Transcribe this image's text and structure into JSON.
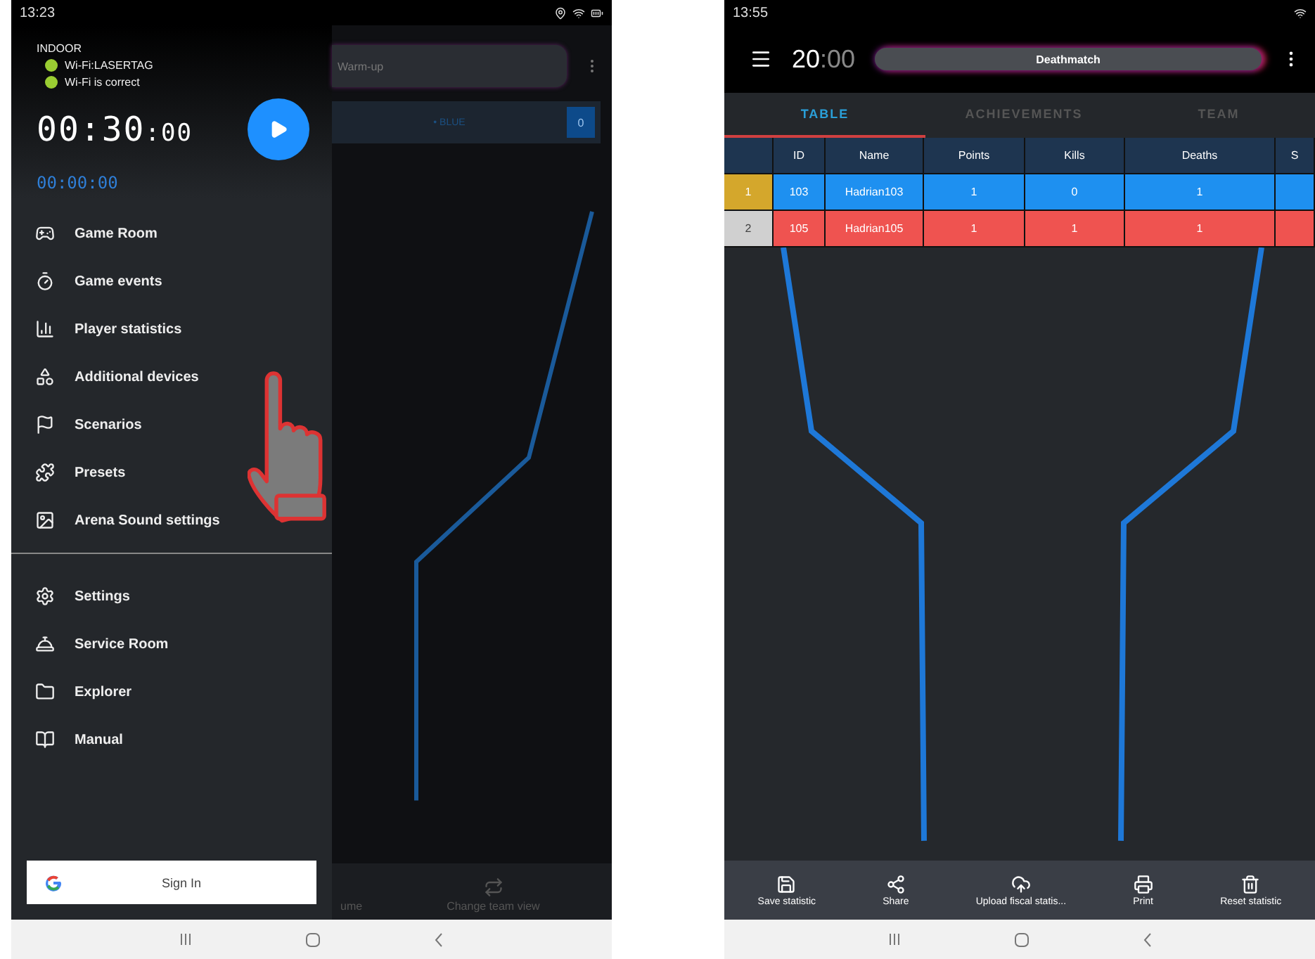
{
  "left_screen": {
    "status_bar": {
      "time": "13:23"
    },
    "drawer": {
      "mode": "INDOOR",
      "wifi": [
        "Wi-Fi:LASERTAG",
        "Wi-Fi is correct"
      ],
      "timer_main": "00:30",
      "timer_small": ":00",
      "elapsed": "00:00:00",
      "items": [
        "Game Room",
        "Game events",
        "Player statistics",
        "Additional devices",
        "Scenarios",
        "Presets",
        "Arena Sound settings"
      ],
      "secondary_items": [
        "Settings",
        "Service Room",
        "Explorer",
        "Manual"
      ],
      "sign_in": "Sign In"
    },
    "main": {
      "mode_field": "Warm-up",
      "team": {
        "name": "• BLUE",
        "score": "0"
      },
      "bottom_actions": [
        "ume",
        "Change team view"
      ]
    }
  },
  "right_screen": {
    "status_bar": {
      "time": "13:55"
    },
    "app_bar": {
      "time_main": "20",
      "time_small": ":00",
      "mode": "Deathmatch"
    },
    "tabs": [
      {
        "label": "TABLE",
        "selected": true
      },
      {
        "label": "ACHIEVEMENTS",
        "selected": false
      },
      {
        "label": "TEAM",
        "selected": false
      }
    ],
    "table": {
      "columns": [
        "",
        "ID",
        "Name",
        "Points",
        "Kills",
        "Deaths",
        "S"
      ],
      "rows": [
        {
          "rank": {
            "color": "#d4a72c"
          },
          "color": "#1e90f0",
          "cells": [
            "1",
            "103",
            "Hadrian103",
            "1",
            "0",
            "1"
          ]
        },
        {
          "rank": {
            "color": "#d0d0d0"
          },
          "color": "#ef5350",
          "cells": [
            "2",
            "105",
            "Hadrian105",
            "1",
            "1",
            "1"
          ]
        }
      ]
    },
    "toolbar": [
      "Save statistic",
      "Share",
      "Upload fiscal statis...",
      "Print",
      "Reset statistic"
    ]
  }
}
